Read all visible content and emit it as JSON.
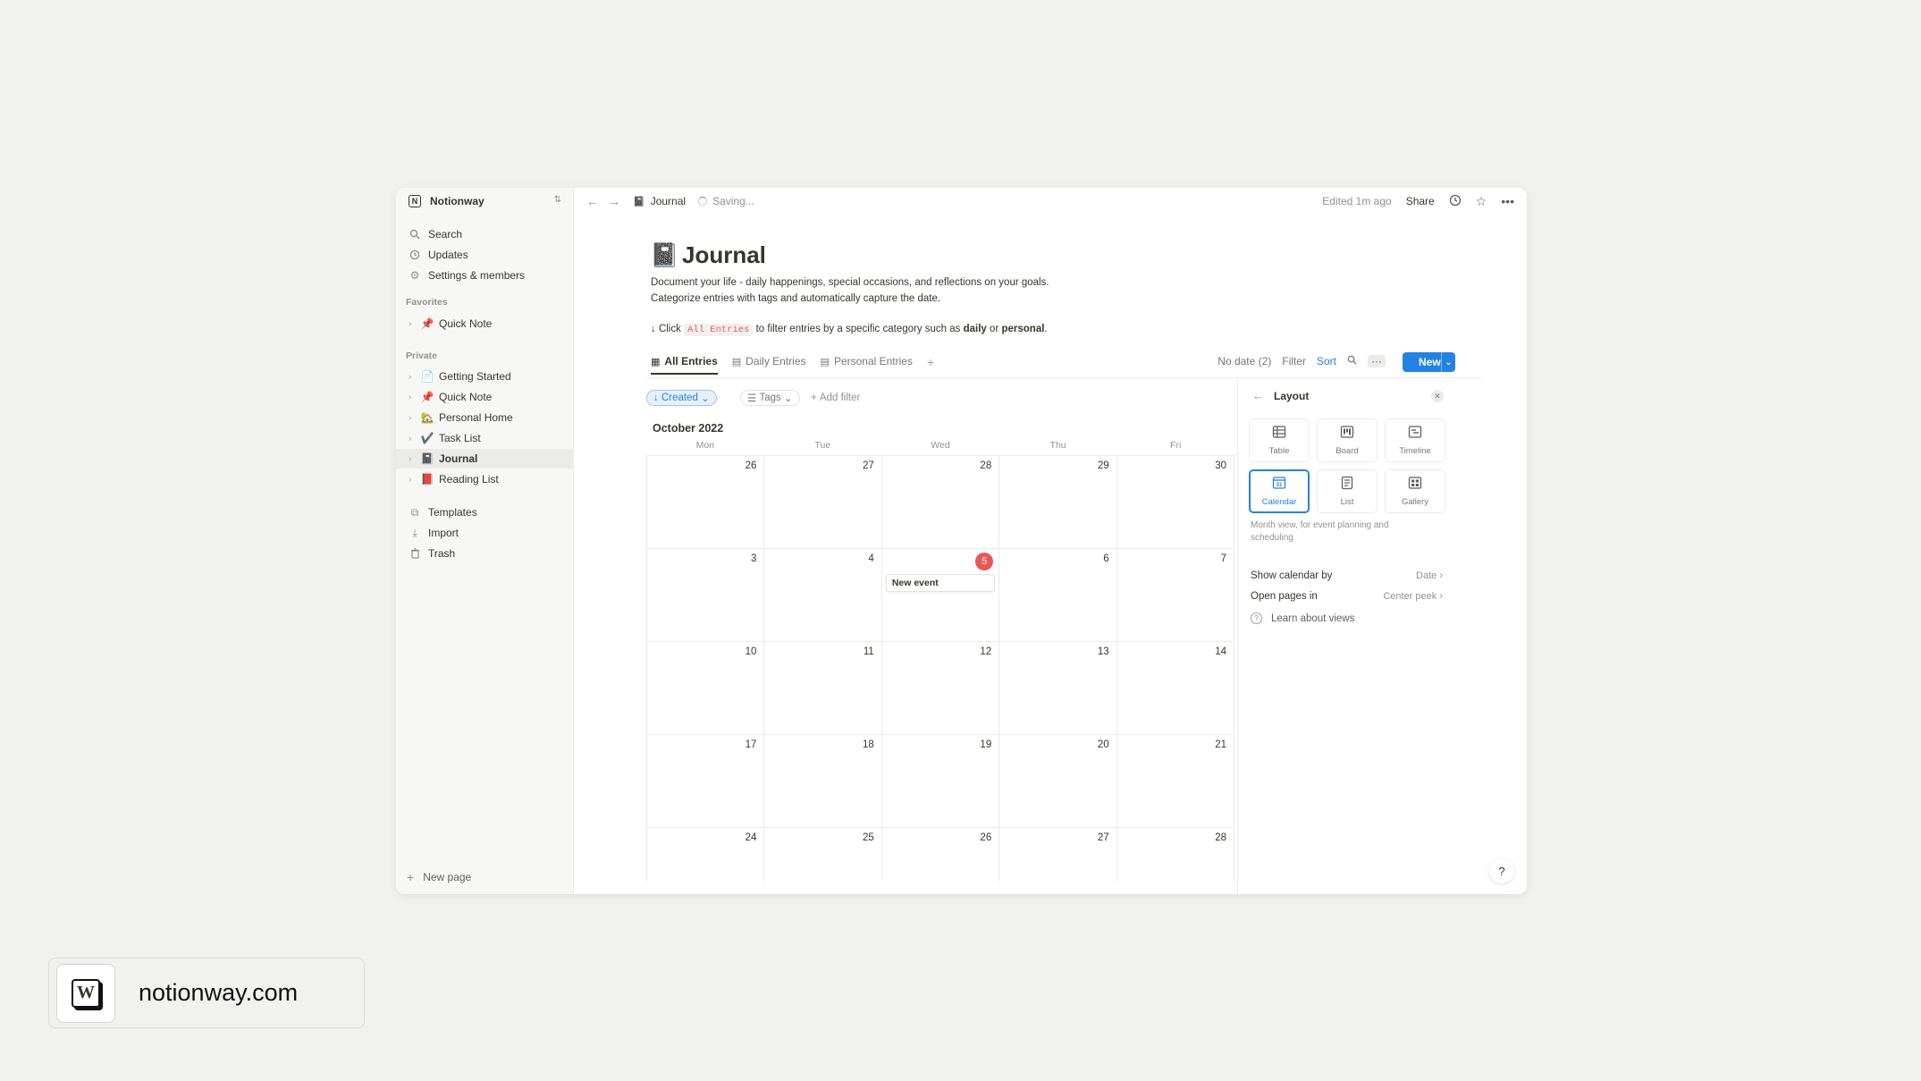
{
  "sidebar": {
    "workspace": "Notionway",
    "top_items": [
      {
        "icon": "search-icon",
        "label": "Search"
      },
      {
        "icon": "clock-icon",
        "label": "Updates"
      },
      {
        "icon": "gear-icon",
        "label": "Settings & members"
      }
    ],
    "favorites_label": "Favorites",
    "favorites": [
      {
        "icon": "📌",
        "label": "Quick Note"
      }
    ],
    "private_label": "Private",
    "private": [
      {
        "icon": "📄",
        "label": "Getting Started"
      },
      {
        "icon": "📌",
        "label": "Quick Note"
      },
      {
        "icon": "🏡",
        "label": "Personal Home"
      },
      {
        "icon": "✔️",
        "label": "Task List"
      },
      {
        "icon": "📓",
        "label": "Journal"
      },
      {
        "icon": "📕",
        "label": "Reading List"
      }
    ],
    "bottom_items": [
      {
        "icon": "templates-icon",
        "label": "Templates"
      },
      {
        "icon": "import-icon",
        "label": "Import"
      },
      {
        "icon": "trash-icon",
        "label": "Trash"
      }
    ],
    "new_page": "New page"
  },
  "topbar": {
    "breadcrumb": "Journal",
    "saving": "Saving...",
    "edited": "Edited 1m ago",
    "share": "Share"
  },
  "page": {
    "icon": "📓",
    "title": "Journal",
    "desc_line1": "Document your life - daily happenings, special occasions, and reflections on your goals.",
    "desc_line2": "Categorize entries with tags and automatically capture the date.",
    "tip_prefix": "↓ Click",
    "tip_code": "All Entries",
    "tip_mid": "to filter entries by a specific category such as",
    "tip_daily": "daily",
    "tip_or": "or",
    "tip_personal": "personal",
    "tip_end": "."
  },
  "tabs": [
    {
      "label": "All Entries"
    },
    {
      "label": "Daily Entries"
    },
    {
      "label": "Personal Entries"
    }
  ],
  "tools": {
    "no_date": "No date (2)",
    "filter": "Filter",
    "sort": "Sort",
    "new": "New"
  },
  "filters": {
    "created": "Created",
    "tags": "Tags",
    "add_filter": "Add filter"
  },
  "calendar": {
    "month": "October 2022",
    "weekdays": [
      "Mon",
      "Tue",
      "Wed",
      "Thu",
      "Fri"
    ],
    "weeks": [
      [
        "26",
        "27",
        "28",
        "29",
        "30"
      ],
      [
        "3",
        "4",
        "5",
        "6",
        "7"
      ],
      [
        "10",
        "11",
        "12",
        "13",
        "14"
      ],
      [
        "17",
        "18",
        "19",
        "20",
        "21"
      ],
      [
        "24",
        "25",
        "26",
        "27",
        "28"
      ]
    ],
    "event_label": "New event"
  },
  "panel": {
    "title": "Layout",
    "layouts": [
      {
        "label": "Table",
        "icon": "table-icon"
      },
      {
        "label": "Board",
        "icon": "board-icon"
      },
      {
        "label": "Timeline",
        "icon": "timeline-icon"
      },
      {
        "label": "Calendar",
        "icon": "calendar-icon"
      },
      {
        "label": "List",
        "icon": "list-icon"
      },
      {
        "label": "Gallery",
        "icon": "gallery-icon"
      }
    ],
    "selected_layout": "Calendar",
    "help": "Month view, for event planning and scheduling",
    "show_by_label": "Show calendar by",
    "show_by_value": "Date",
    "open_in_label": "Open pages in",
    "open_in_value": "Center peek",
    "learn": "Learn about views"
  },
  "brand": {
    "logo_letter": "W",
    "text": "notionway.com"
  },
  "colors": {
    "accent": "#2383e2",
    "today": "#eb5757"
  }
}
